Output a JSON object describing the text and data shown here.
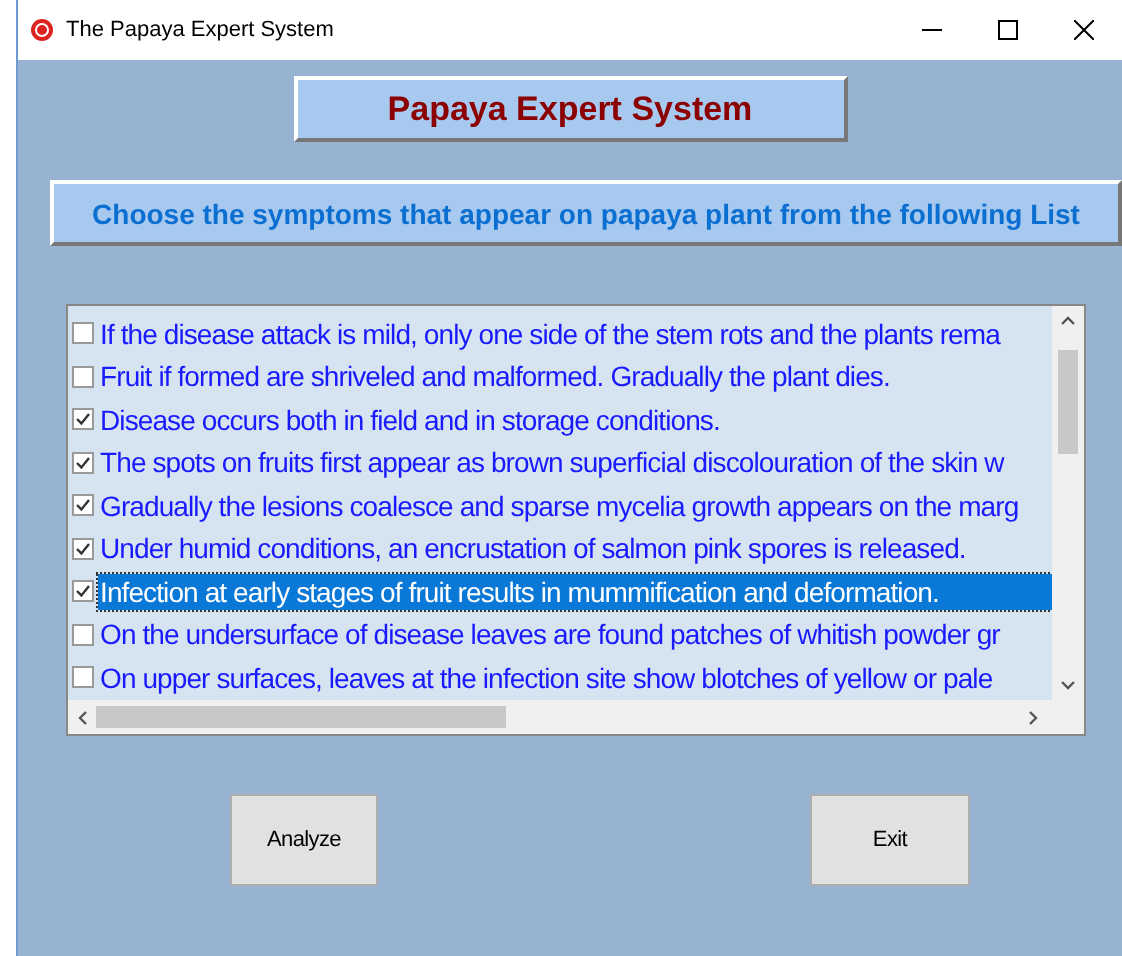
{
  "window": {
    "title": "The Papaya Expert System"
  },
  "heading": "Papaya Expert System",
  "instruction": "Choose the symptoms that appear on papaya  plant from the following List",
  "symptoms": [
    {
      "text": "If the disease attack is mild, only one side of the stem rots and the plants rema",
      "checked": false,
      "selected": false
    },
    {
      "text": "Fruit if formed are shriveled and malformed. Gradually the plant dies.",
      "checked": false,
      "selected": false
    },
    {
      "text": "Disease occurs both in field and in storage conditions.",
      "checked": true,
      "selected": false
    },
    {
      "text": "The spots on fruits first appear as brown superficial discolouration of the skin w",
      "checked": true,
      "selected": false
    },
    {
      "text": "Gradually the lesions coalesce and sparse mycelia growth appears on the marg",
      "checked": true,
      "selected": false
    },
    {
      "text": "Under humid conditions, an encrustation of salmon pink spores is released.",
      "checked": true,
      "selected": false
    },
    {
      "text": "Infection at early stages of fruit results in mummification and deformation.",
      "checked": true,
      "selected": true
    },
    {
      "text": "On the undersurface of disease leaves are found patches of whitish powder gr",
      "checked": false,
      "selected": false
    },
    {
      "text": "On upper surfaces, leaves at the infection site show blotches of yellow or pale",
      "checked": false,
      "selected": false
    }
  ],
  "buttons": [
    {
      "label": "Analyze"
    },
    {
      "label": "Exit"
    }
  ]
}
